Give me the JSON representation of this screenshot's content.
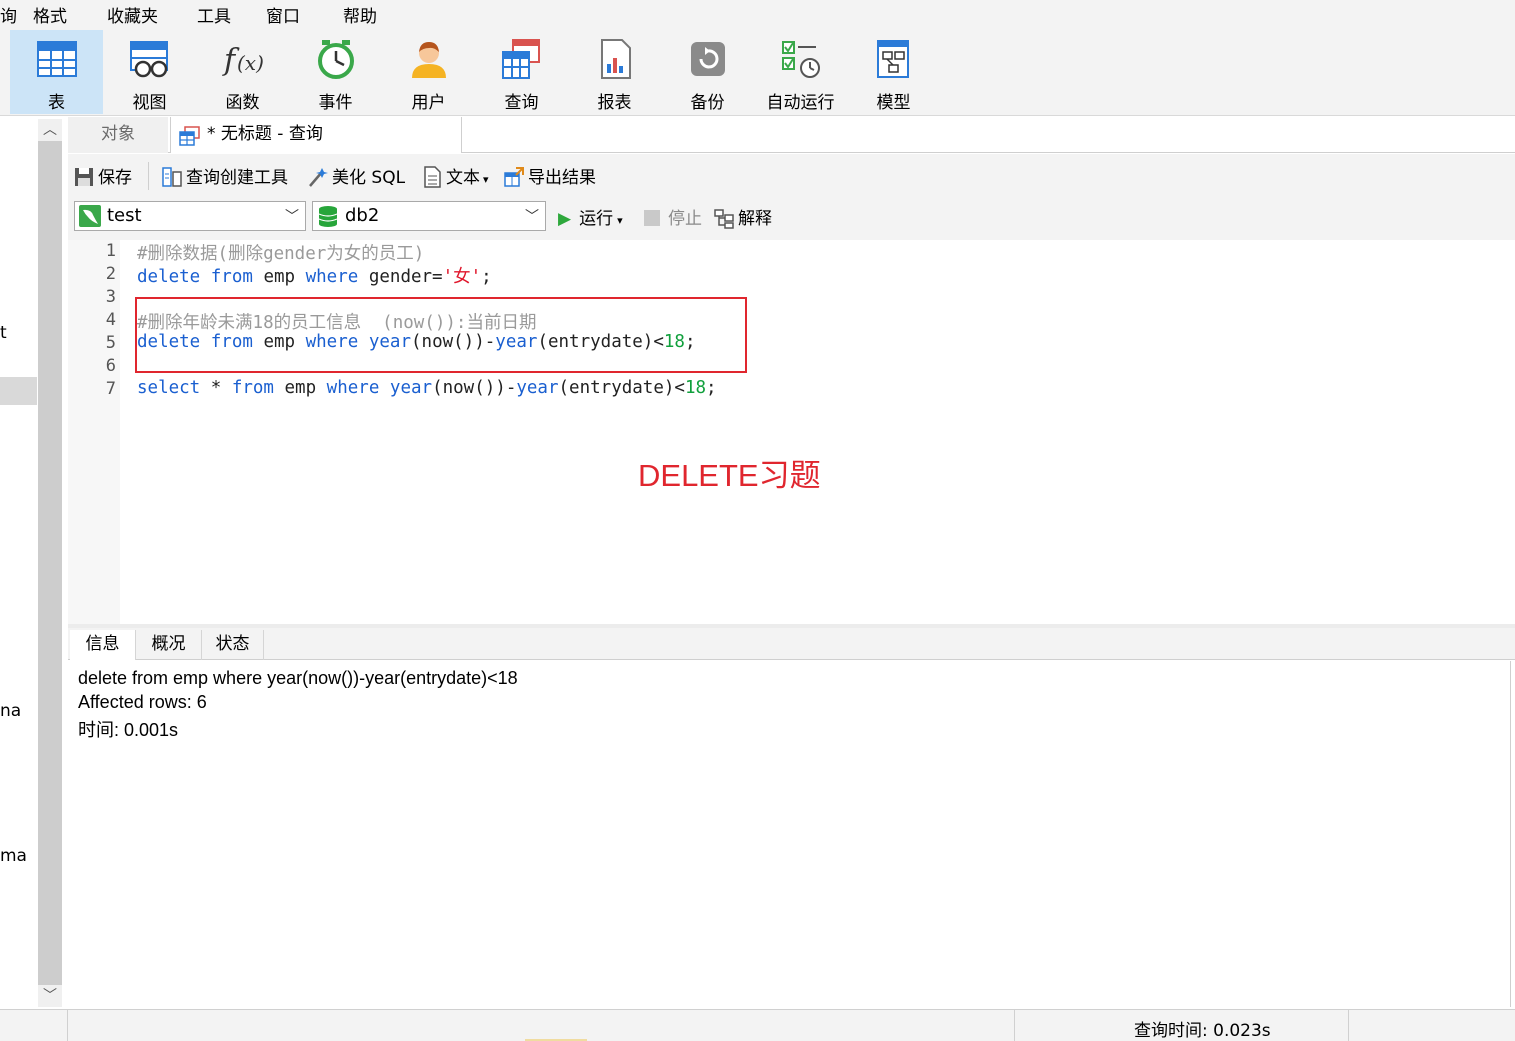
{
  "menu": [
    "询",
    "格式",
    "收藏夹",
    "工具",
    "窗口",
    "帮助"
  ],
  "ribbon": [
    {
      "label": "表",
      "icon": "table-icon",
      "active": true
    },
    {
      "label": "视图",
      "icon": "view-icon"
    },
    {
      "label": "函数",
      "icon": "function-icon"
    },
    {
      "label": "事件",
      "icon": "event-clock-icon"
    },
    {
      "label": "用户",
      "icon": "user-icon"
    },
    {
      "label": "查询",
      "icon": "query-icon"
    },
    {
      "label": "报表",
      "icon": "report-icon"
    },
    {
      "label": "备份",
      "icon": "backup-icon"
    },
    {
      "label": "自动运行",
      "icon": "auto-run-icon"
    },
    {
      "label": "模型",
      "icon": "model-icon"
    }
  ],
  "left_panel": {
    "fragments": [
      "t",
      "na",
      "ma"
    ]
  },
  "tabs": {
    "objects": "对象",
    "query": "* 无标题 - 查询"
  },
  "toolbar": {
    "save": "保存",
    "query_builder": "查询创建工具",
    "beautify": "美化 SQL",
    "text": "文本",
    "export": "导出结果",
    "connection": "test",
    "database": "db2",
    "run": "运行",
    "stop": "停止",
    "explain": "解释"
  },
  "editor": {
    "line_numbers": [
      "1",
      "2",
      "3",
      "4",
      "5",
      "6",
      "7"
    ],
    "lines": {
      "l1": "#删除数据(删除gender为女的员工)",
      "l2": [
        {
          "t": "delete",
          "c": "kw"
        },
        {
          "t": " "
        },
        {
          "t": "from",
          "c": "kw"
        },
        {
          "t": " emp "
        },
        {
          "t": "where",
          "c": "kw"
        },
        {
          "t": " gender="
        },
        {
          "t": "'女'",
          "c": "str"
        },
        {
          "t": ";"
        }
      ],
      "l4": "#删除年龄未满18的员工信息  (now()):当前日期",
      "l5": [
        {
          "t": "delete",
          "c": "kw"
        },
        {
          "t": " "
        },
        {
          "t": "from",
          "c": "kw"
        },
        {
          "t": " emp "
        },
        {
          "t": "where",
          "c": "kw"
        },
        {
          "t": " "
        },
        {
          "t": "year",
          "c": "kw"
        },
        {
          "t": "(now())-"
        },
        {
          "t": "year",
          "c": "kw"
        },
        {
          "t": "(entrydate)<"
        },
        {
          "t": "18",
          "c": "num"
        },
        {
          "t": ";"
        }
      ],
      "l7": [
        {
          "t": "select",
          "c": "kw"
        },
        {
          "t": " * "
        },
        {
          "t": "from",
          "c": "kw"
        },
        {
          "t": " emp "
        },
        {
          "t": "where",
          "c": "kw"
        },
        {
          "t": " "
        },
        {
          "t": "year",
          "c": "kw"
        },
        {
          "t": "(now())-"
        },
        {
          "t": "year",
          "c": "kw"
        },
        {
          "t": "(entrydate)<"
        },
        {
          "t": "18",
          "c": "num"
        },
        {
          "t": ";"
        }
      ]
    },
    "annotation": "DELETE习题"
  },
  "result": {
    "tabs": [
      "信息",
      "概况",
      "状态"
    ],
    "lines": [
      "delete from emp where year(now())-year(entrydate)<18",
      "Affected rows: 6",
      "时间: 0.001s"
    ]
  },
  "status": {
    "query_time": "查询时间: 0.023s"
  },
  "colors": {
    "keyword": "#1a5fd0",
    "comment": "#9a9a9a",
    "string": "#e0162b",
    "number": "#10a03c",
    "highlight": "#e0262e",
    "ribbon_active": "#cce4f7"
  }
}
